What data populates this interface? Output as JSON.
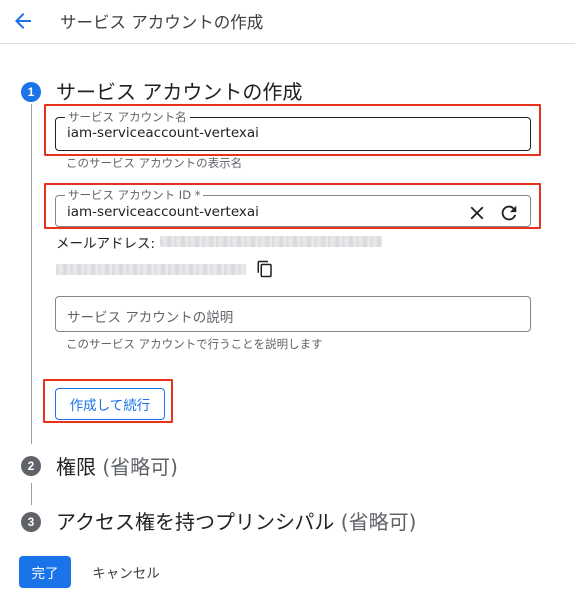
{
  "header": {
    "title": "サービス アカウントの作成",
    "back_icon": "arrow-back-icon",
    "accent_color": "#1a73e8"
  },
  "steps": [
    {
      "number": "1",
      "title": "サービス アカウントの作成",
      "state": "active"
    },
    {
      "number": "2",
      "title": "権限",
      "optional": "(省略可)",
      "state": "inactive"
    },
    {
      "number": "3",
      "title": "アクセス権を持つプリンシパル",
      "optional": "(省略可)",
      "state": "inactive"
    }
  ],
  "form": {
    "name_field": {
      "label": "サービス アカウント名",
      "value": "iam-serviceaccount-vertexai",
      "hint": "このサービス アカウントの表示名"
    },
    "id_field": {
      "label": "サービス アカウント ID *",
      "value": "iam-serviceaccount-vertexai",
      "clear_icon": "close-icon",
      "refresh_icon": "refresh-icon"
    },
    "email_label": "メールアドレス:",
    "copy_icon": "copy-icon",
    "description_field": {
      "placeholder": "サービス アカウントの説明",
      "hint": "このサービス アカウントで行うことを説明します"
    },
    "create_button": "作成して続行"
  },
  "footer": {
    "done_button": "完了",
    "cancel_button": "キャンセル"
  },
  "highlight_color": "#e8321c"
}
